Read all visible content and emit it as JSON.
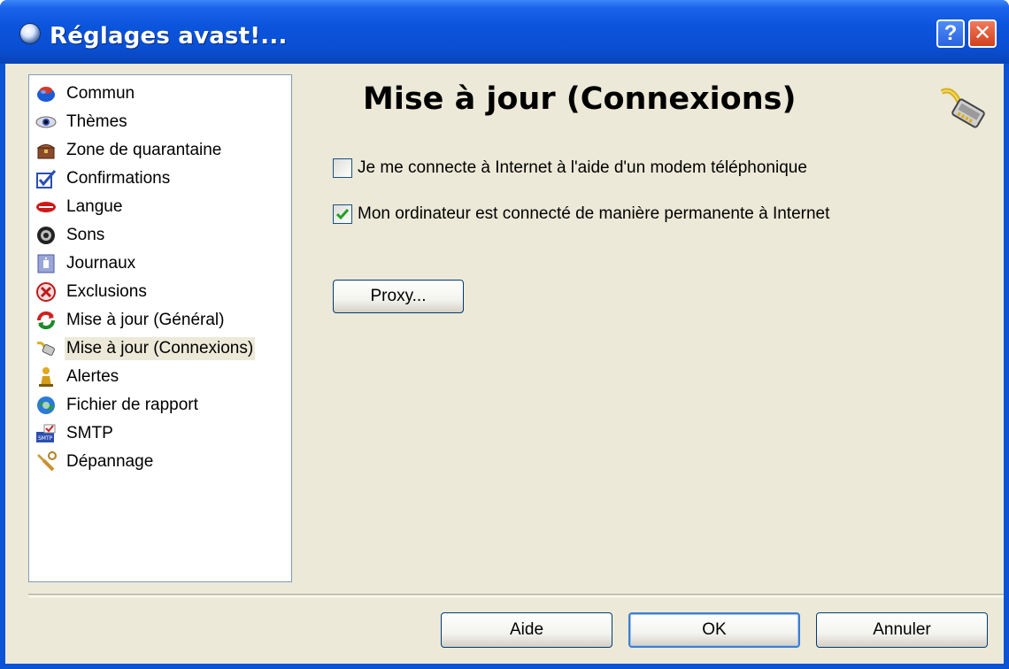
{
  "window": {
    "title": "Réglages avast!...",
    "help_label": "?",
    "close_label": "✕"
  },
  "sidebar": {
    "items": [
      {
        "label": "Commun",
        "icon": "globe-icon"
      },
      {
        "label": "Thèmes",
        "icon": "eye-icon"
      },
      {
        "label": "Zone de quarantaine",
        "icon": "chest-icon"
      },
      {
        "label": "Confirmations",
        "icon": "checklist-icon"
      },
      {
        "label": "Langue",
        "icon": "lips-icon"
      },
      {
        "label": "Sons",
        "icon": "speaker-icon"
      },
      {
        "label": "Journaux",
        "icon": "log-icon"
      },
      {
        "label": "Exclusions",
        "icon": "exclusion-icon"
      },
      {
        "label": "Mise à jour (Général)",
        "icon": "update-icon"
      },
      {
        "label": "Mise à jour (Connexions)",
        "icon": "network-cable-icon"
      },
      {
        "label": "Alertes",
        "icon": "alert-figure-icon"
      },
      {
        "label": "Fichier de rapport",
        "icon": "report-icon"
      },
      {
        "label": "SMTP",
        "icon": "smtp-icon"
      },
      {
        "label": "Dépannage",
        "icon": "troubleshoot-icon"
      }
    ],
    "selected_index": 9
  },
  "main": {
    "title": "Mise à jour (Connexions)",
    "options": [
      {
        "label": "Je me connecte à Internet à l'aide d'un modem téléphonique",
        "checked": false
      },
      {
        "label": "Mon ordinateur est connecté de manière permanente à Internet",
        "checked": true
      }
    ],
    "proxy_label": "Proxy..."
  },
  "footer": {
    "help_label": "Aide",
    "ok_label": "OK",
    "cancel_label": "Annuler"
  },
  "colors": {
    "titlebar": "#0a52d6",
    "dialog_bg": "#ece9d8",
    "check_green": "#21a121"
  }
}
